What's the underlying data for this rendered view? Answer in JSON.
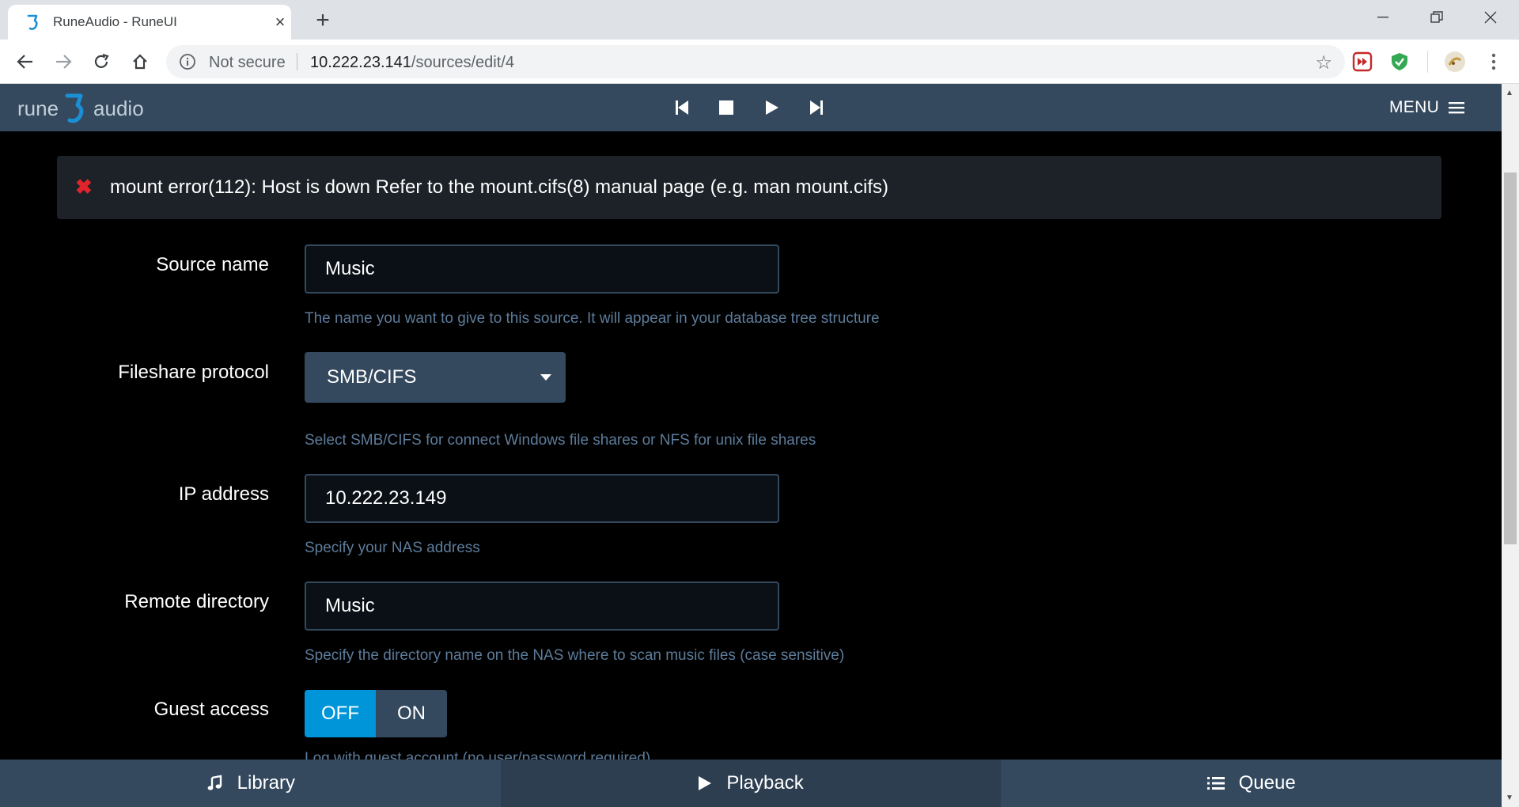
{
  "browser": {
    "tab_title": "RuneAudio - RuneUI",
    "close_tab_glyph": "×",
    "new_tab_glyph": "+",
    "security_label": "Not secure",
    "url_host": "10.222.23.141",
    "url_path": "/sources/edit/4"
  },
  "header": {
    "logo_left": "rune",
    "logo_right": "audio",
    "menu_label": "MENU"
  },
  "alert": {
    "icon": "✖",
    "message": "mount error(112): Host is down Refer to the mount.cifs(8) manual page (e.g. man mount.cifs)"
  },
  "form": {
    "source_name": {
      "label": "Source name",
      "value": "Music",
      "help": "The name you want to give to this source. It will appear in your database tree structure"
    },
    "protocol": {
      "label": "Fileshare protocol",
      "value": "SMB/CIFS",
      "help": "Select SMB/CIFS for connect Windows file shares or NFS for unix file shares"
    },
    "ip": {
      "label": "IP address",
      "value": "10.222.23.149",
      "help": "Specify your NAS address"
    },
    "remote_dir": {
      "label": "Remote directory",
      "value": "Music",
      "help": "Specify the directory name on the NAS where to scan music files (case sensitive)"
    },
    "guest": {
      "label": "Guest access",
      "off_label": "OFF",
      "on_label": "ON",
      "selected": "OFF",
      "help_partial": "Log with guest account (no user/password required)"
    }
  },
  "bottom_nav": {
    "library": "Library",
    "playback": "Playback",
    "queue": "Queue",
    "active": "Playback"
  },
  "colors": {
    "header_bg": "#34495e",
    "accent": "#0095d8",
    "error": "#e0242c",
    "help_text": "#5d7c9b"
  }
}
